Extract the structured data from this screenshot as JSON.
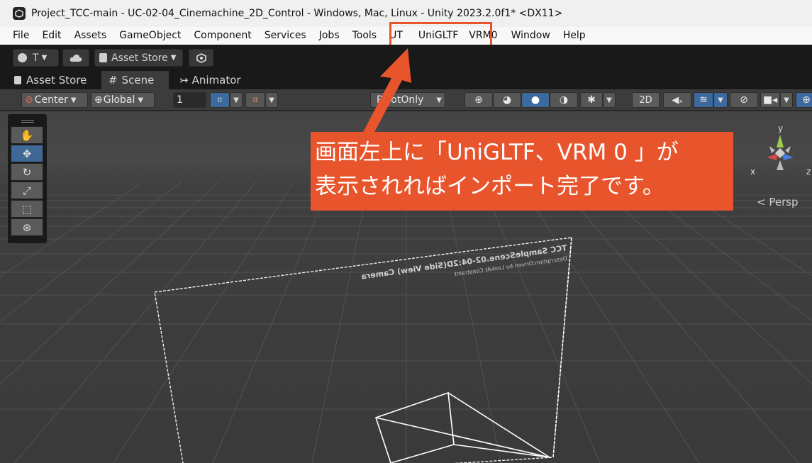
{
  "window": {
    "title": "Project_TCC-main - UC-02-04_Cinemachine_2D_Control - Windows, Mac, Linux - Unity 2023.2.0f1* <DX11>"
  },
  "menubar": {
    "items": [
      "File",
      "Edit",
      "Assets",
      "GameObject",
      "Component",
      "Services",
      "Jobs",
      "Tools",
      "UT",
      "UniGLTF",
      "VRM0",
      "Window",
      "Help"
    ]
  },
  "toolbar": {
    "account": "T",
    "asset_store": "Asset Store"
  },
  "tabs": {
    "asset_store": "Asset Store",
    "scene": "Scene",
    "animator": "Animator"
  },
  "scenebar": {
    "pivot": "Center",
    "space": "Global",
    "grid_value": "1",
    "draw_mode": "PivotOnly",
    "two_d": "2D"
  },
  "gizmo": {
    "y": "y",
    "x": "x",
    "z": "z",
    "persp": "< Persp"
  },
  "camera": {
    "label": "TCC SampleScene.02-04:2D(Side View) Camera",
    "sub": "Description:Driven by LookAt Constraint"
  },
  "callout": {
    "line1": "画面左上に「UniGLTF、VRM 0 」が",
    "line2": "表示されればインポート完了です。"
  },
  "colors": {
    "accent": "#e8542c",
    "active": "#3d6a9e"
  }
}
